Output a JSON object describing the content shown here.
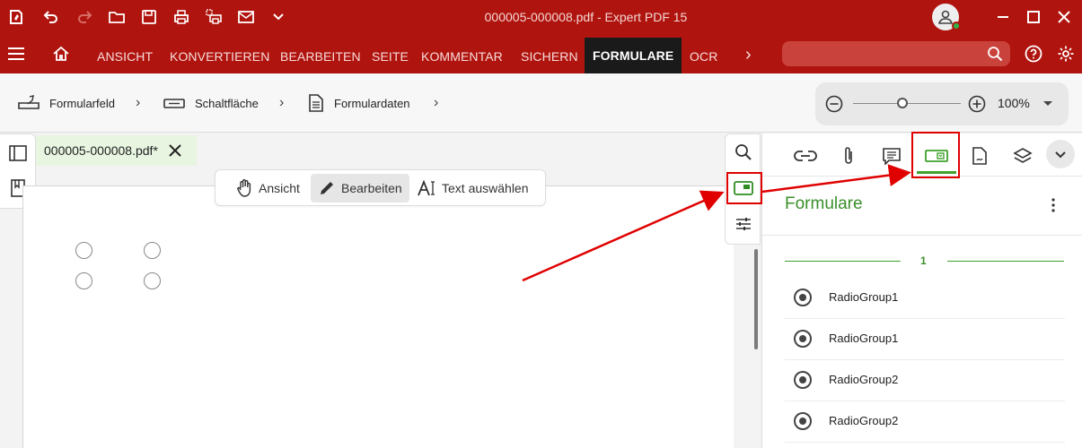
{
  "window": {
    "title": "000005-000008.pdf  -  Expert PDF 15"
  },
  "menu": {
    "items": [
      "ANSICHT",
      "KONVERTIEREN",
      "BEARBEITEN",
      "SEITE",
      "KOMMENTAR",
      "SICHERN",
      "FORMULARE",
      "OCR"
    ],
    "active": "FORMULARE",
    "more_glyph": "›"
  },
  "ribbon": {
    "items": [
      "Formularfeld",
      "Schaltfläche",
      "Formulardaten"
    ],
    "chevron": "›"
  },
  "zoom": {
    "value_label": "100%",
    "level_fraction": 0.46
  },
  "tab": {
    "label": "000005-000008.pdf*"
  },
  "modes": {
    "view": "Ansicht",
    "edit": "Bearbeiten",
    "select_text": "Text auswählen",
    "active": "Bearbeiten"
  },
  "panel": {
    "title": "Formulare",
    "page_label": "1",
    "items": [
      "RadioGroup1",
      "RadioGroup1",
      "RadioGroup2",
      "RadioGroup2"
    ]
  },
  "colors": {
    "brand_red": "#b0140e",
    "accent_green": "#3a8f2a",
    "annotation_red": "#e00000"
  }
}
